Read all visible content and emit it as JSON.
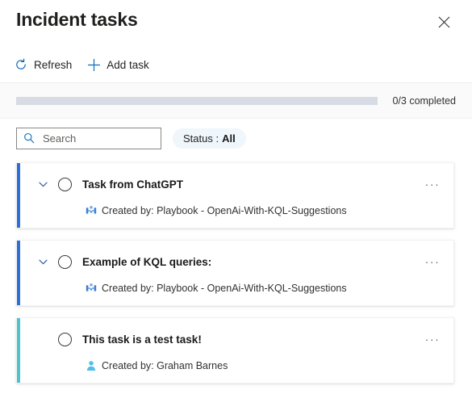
{
  "panel": {
    "title": "Incident tasks",
    "close_icon": "close-icon"
  },
  "command_bar": {
    "refresh": {
      "label": "Refresh",
      "icon": "refresh-icon"
    },
    "add_task": {
      "label": "Add task",
      "icon": "plus-icon"
    }
  },
  "progress": {
    "completed": 0,
    "total": 3,
    "percent": 0,
    "label": "0/3 completed",
    "track_color": "#d7dbe3",
    "fill_color": "#0f6cbd"
  },
  "filters": {
    "search": {
      "placeholder": "Search",
      "value": "",
      "icon": "search-icon"
    },
    "status_filter": {
      "label": "Status :",
      "value": "All",
      "pill_color": "#eff6fc"
    }
  },
  "tasks": [
    {
      "title": "Task from ChatGPT",
      "created_by": "Created by: Playbook - OpenAi-With-KQL-Suggestions",
      "creator_icon": "playbook-icon",
      "accent_color": "#2b6fd8",
      "has_chevron": true,
      "expanded": false,
      "checked": false,
      "more_label": "···"
    },
    {
      "title": "Example of KQL queries:",
      "created_by": "Created by: Playbook - OpenAi-With-KQL-Suggestions",
      "creator_icon": "playbook-icon",
      "accent_color": "#2b6fd8",
      "has_chevron": true,
      "expanded": false,
      "checked": false,
      "more_label": "···"
    },
    {
      "title": "This task is a test task!",
      "created_by": "Created by: Graham Barnes",
      "creator_icon": "user-icon",
      "accent_color": "#4ec3cd",
      "has_chevron": false,
      "expanded": false,
      "checked": false,
      "more_label": "···"
    }
  ]
}
